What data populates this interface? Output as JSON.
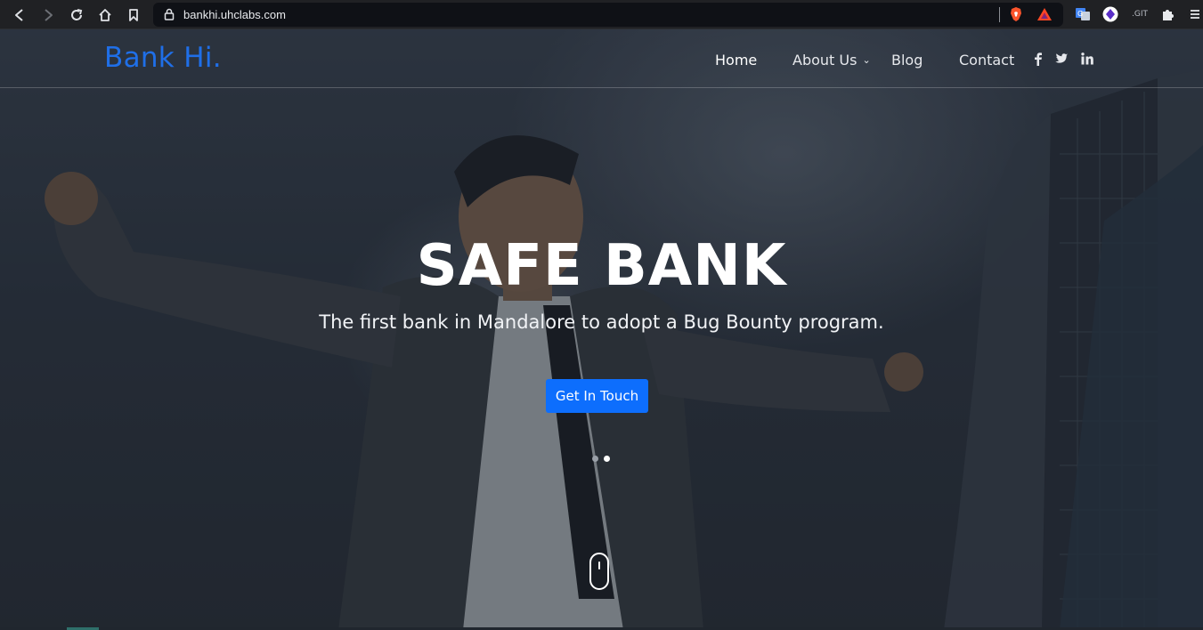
{
  "browser": {
    "url": "bankhi.uhclabs.com",
    "extensions": [
      "brave-icon",
      "bat-icon",
      "translate-icon",
      "profile-icon",
      "git-icon",
      "puzzle-icon",
      "menu-icon"
    ],
    "git_label": ".GIT"
  },
  "site": {
    "brand": "Bank Hi.",
    "nav": [
      {
        "label": "Home",
        "active": true
      },
      {
        "label": "About Us",
        "dropdown": true
      },
      {
        "label": "Blog"
      },
      {
        "label": "Contact"
      }
    ],
    "social": [
      "facebook-icon",
      "twitter-icon",
      "linkedin-icon"
    ],
    "nav_chevron": "⌄"
  },
  "hero": {
    "title": "SAFE BANK",
    "subtitle": "The first bank in Mandalore to adopt a Bug Bounty program.",
    "cta_label": "Get In Touch",
    "slides": 2,
    "active_slide": 2
  },
  "colors": {
    "brand": "#1f6fe8",
    "cta": "#0d6efd"
  }
}
